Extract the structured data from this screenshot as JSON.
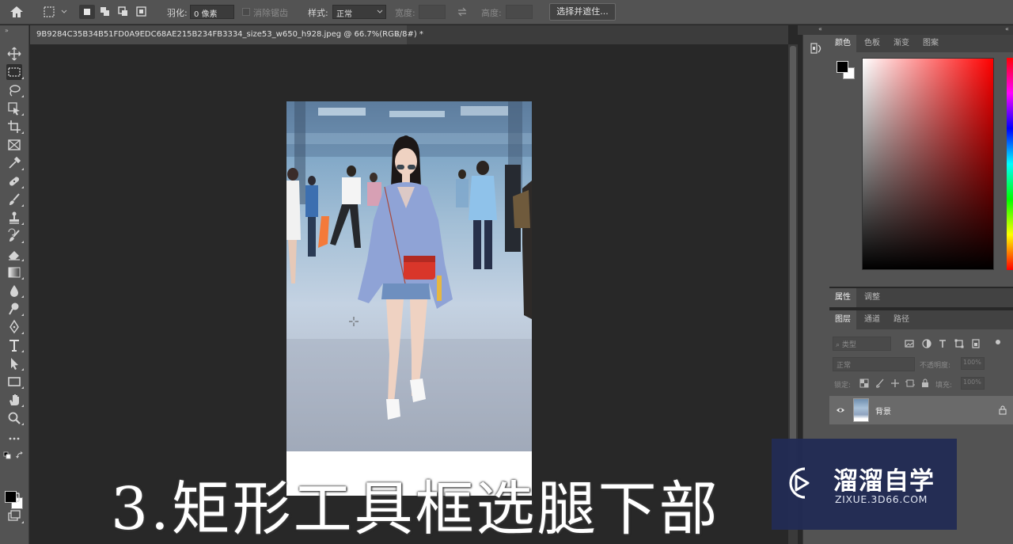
{
  "options_bar": {
    "feather_label": "羽化:",
    "feather_value": "0 像素",
    "antialias_label": "消除锯齿",
    "style_label": "样式:",
    "style_value": "正常",
    "width_label": "宽度:",
    "height_label": "高度:",
    "select_mask_button": "选择并遮住..."
  },
  "document_tab": {
    "title": "9B9284C35B34B51FD0A9EDC68AE215B234FB3334_size53_w650_h928.jpeg @ 66.7%(RGB/8#) *",
    "close_glyph": "×"
  },
  "tools": [
    "move-tool",
    "rectangular-marquee-tool",
    "lasso-tool",
    "object-selection-tool",
    "crop-tool",
    "frame-tool",
    "eyedropper-tool",
    "healing-brush-tool",
    "brush-tool",
    "clone-stamp-tool",
    "history-brush-tool",
    "eraser-tool",
    "gradient-tool",
    "blur-tool",
    "dodge-tool",
    "pen-tool",
    "type-tool",
    "path-selection-tool",
    "rectangle-tool",
    "hand-tool",
    "zoom-tool",
    "more-tools"
  ],
  "color_panel": {
    "tabs": [
      {
        "label": "颜色",
        "active": true
      },
      {
        "label": "色板",
        "active": false
      },
      {
        "label": "渐变",
        "active": false
      },
      {
        "label": "图案",
        "active": false
      }
    ],
    "foreground": "#000000",
    "background": "#ffffff",
    "hue_color": "#ff0000"
  },
  "properties_panel": {
    "tabs": [
      {
        "label": "属性",
        "active": true
      },
      {
        "label": "调整",
        "active": false
      }
    ]
  },
  "layers_panel": {
    "tabs": [
      {
        "label": "图层",
        "active": true
      },
      {
        "label": "通道",
        "active": false
      },
      {
        "label": "路径",
        "active": false
      }
    ],
    "filter_placeholder": "类型",
    "blend_mode": "正常",
    "opacity_label": "不透明度:",
    "opacity_value": "100%",
    "lock_label": "锁定:",
    "fill_label": "填充:",
    "fill_value": "100%",
    "layers": [
      {
        "name": "背景",
        "visible": true,
        "locked": true
      }
    ]
  },
  "caption": "3.矩形工具框选腿下部",
  "watermark": {
    "name": "溜溜自学",
    "url": "ZIXUE.3D66.COM"
  }
}
